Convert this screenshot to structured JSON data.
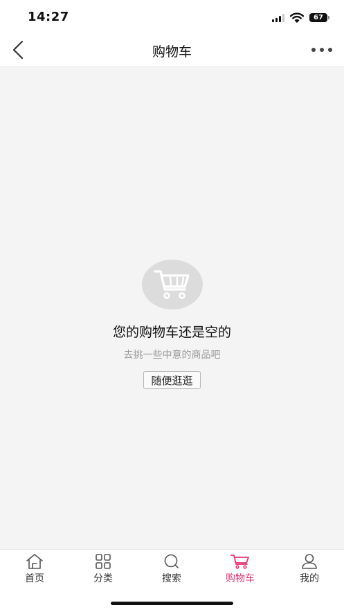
{
  "status_bar": {
    "time": "14:27",
    "battery": "67",
    "icons": [
      "signal-icon",
      "wifi-icon",
      "battery-icon"
    ]
  },
  "nav": {
    "title": "购物车",
    "back_icon": "chevron-left-icon",
    "more_icon": "more-dots-icon"
  },
  "empty_state": {
    "icon": "shopping-cart-icon",
    "title": "您的购物车还是空的",
    "subtitle": "去挑一些中意的商品吧",
    "button_label": "随便逛逛"
  },
  "tab_bar": {
    "items": [
      {
        "label": "首页",
        "icon": "home-icon",
        "active": false
      },
      {
        "label": "分类",
        "icon": "grid-icon",
        "active": false
      },
      {
        "label": "搜索",
        "icon": "search-icon",
        "active": false
      },
      {
        "label": "购物车",
        "icon": "cart-icon",
        "active": true
      },
      {
        "label": "我的",
        "icon": "user-icon",
        "active": false
      }
    ]
  },
  "colors": {
    "accent": "#e8336f",
    "background": "#f4f4f4",
    "muted_text": "#999999"
  }
}
